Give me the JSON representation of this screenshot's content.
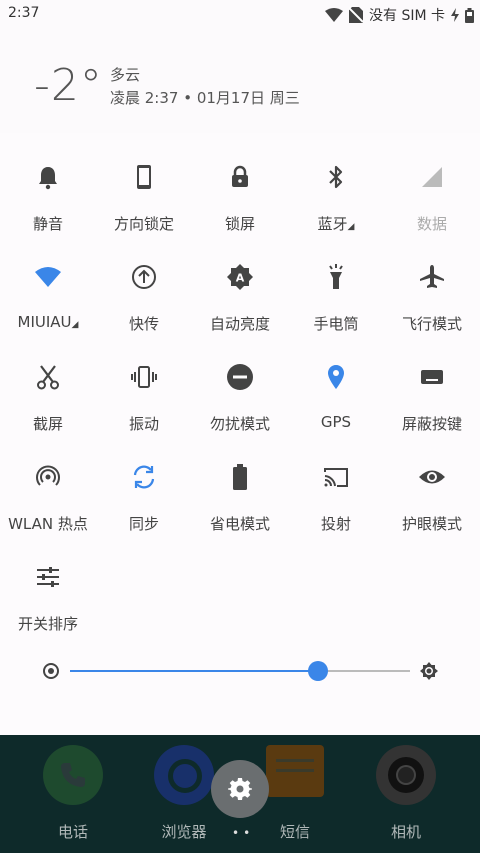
{
  "status_bar": {
    "time": "2:37",
    "carrier": "没有 SIM 卡",
    "icons": [
      "wifi-icon",
      "no-sim-icon",
      "charging-icon",
      "battery-icon"
    ]
  },
  "header": {
    "temperature": "-2°",
    "weather": "多云",
    "datetime": "凌晨 2:37 • 01月17日  周三"
  },
  "tiles": [
    {
      "label": "静音",
      "icon": "bell-icon"
    },
    {
      "label": "方向锁定",
      "icon": "phone-portrait-icon"
    },
    {
      "label": "锁屏",
      "icon": "lock-icon"
    },
    {
      "label": "蓝牙",
      "icon": "bluetooth-icon"
    },
    {
      "label": "数据",
      "icon": "cell-signal-icon"
    },
    {
      "label": "MIUIAU",
      "icon": "wifi-icon"
    },
    {
      "label": "快传",
      "icon": "upload-icon"
    },
    {
      "label": "自动亮度",
      "icon": "auto-brightness-icon"
    },
    {
      "label": "手电筒",
      "icon": "flashlight-icon"
    },
    {
      "label": "飞行模式",
      "icon": "airplane-icon"
    },
    {
      "label": "截屏",
      "icon": "scissors-icon"
    },
    {
      "label": "振动",
      "icon": "vibrate-icon"
    },
    {
      "label": "勿扰模式",
      "icon": "do-not-disturb-icon"
    },
    {
      "label": "GPS",
      "icon": "location-pin-icon"
    },
    {
      "label": "屏蔽按键",
      "icon": "keyboard-icon"
    },
    {
      "label": "WLAN 热点",
      "icon": "hotspot-icon"
    },
    {
      "label": "同步",
      "icon": "sync-icon"
    },
    {
      "label": "省电模式",
      "icon": "battery-saver-icon"
    },
    {
      "label": "投射",
      "icon": "cast-icon"
    },
    {
      "label": "护眼模式",
      "icon": "eye-icon"
    },
    {
      "label": "开关排序",
      "icon": "sliders-icon"
    }
  ],
  "brightness": {
    "level_percent": 73
  },
  "dock": [
    {
      "label": "电话",
      "icon": "phone-icon"
    },
    {
      "label": "浏览器",
      "icon": "browser-icon"
    },
    {
      "label": "短信",
      "icon": "message-icon"
    },
    {
      "label": "相机",
      "icon": "camera-icon"
    }
  ],
  "colors": {
    "accent": "#3a86e8",
    "tile_icon": "#444444",
    "dock_bg": "#0e2a2a"
  }
}
